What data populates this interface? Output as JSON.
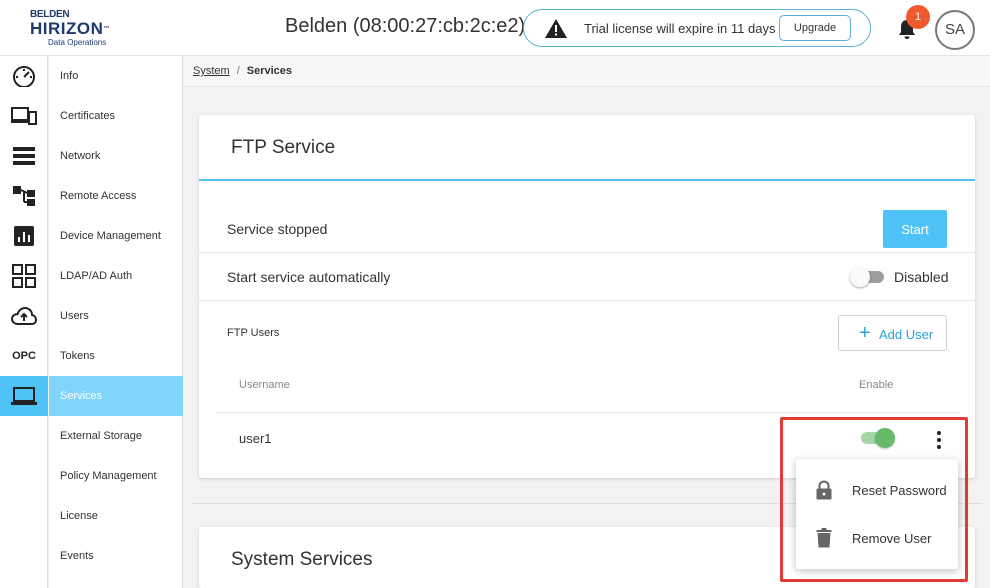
{
  "header": {
    "logo": {
      "line1": "BELDEN",
      "line2": "HIRIZON",
      "tm": "™",
      "line3": "Data Operations"
    },
    "device_title": "Belden (08:00:27:cb:2c:e2)",
    "license_text": "Trial license will expire in 11 days",
    "upgrade_label": "Upgrade",
    "notification_count": "1",
    "avatar_initials": "SA"
  },
  "rail": {
    "items": [
      {
        "icon": "dashboard-icon"
      },
      {
        "icon": "devices-icon"
      },
      {
        "icon": "list-icon"
      },
      {
        "icon": "workflow-icon"
      },
      {
        "icon": "analytics-icon"
      },
      {
        "icon": "apps-icon"
      },
      {
        "icon": "cloud-upload-icon"
      },
      {
        "icon": "opc-icon",
        "label": "OPC"
      },
      {
        "icon": "laptop-icon",
        "active": true
      }
    ],
    "active_color": "#4fc3f7"
  },
  "submenu": {
    "items": [
      {
        "label": "Info"
      },
      {
        "label": "Certificates"
      },
      {
        "label": "Network"
      },
      {
        "label": "Remote Access"
      },
      {
        "label": "Device Management"
      },
      {
        "label": "LDAP/AD Auth"
      },
      {
        "label": "Users"
      },
      {
        "label": "Tokens"
      },
      {
        "label": "Services",
        "active": true
      },
      {
        "label": "External Storage"
      },
      {
        "label": "Policy Management"
      },
      {
        "label": "License"
      },
      {
        "label": "Events"
      }
    ]
  },
  "breadcrumb": {
    "parent": "System",
    "separator": "/",
    "current": "Services"
  },
  "ftp": {
    "title": "FTP Service",
    "status": "Service stopped",
    "start_label": "Start",
    "auto_start_label": "Start service automatically",
    "auto_start_state": "Disabled",
    "users_label": "FTP Users",
    "add_user_plus": "+",
    "add_user_label": "Add User",
    "columns": {
      "username": "Username",
      "enable": "Enable"
    },
    "users": [
      {
        "username": "user1",
        "enabled": true
      }
    ]
  },
  "popup_menu": {
    "items": [
      {
        "label": "Reset Password",
        "icon": "lock-icon"
      },
      {
        "label": "Remove User",
        "icon": "trash-icon"
      }
    ]
  },
  "system_services": {
    "title": "System Services"
  },
  "colors": {
    "accent": "#4fc3f7",
    "highlight": "#e53935",
    "badge": "#ef5a2e",
    "toggle_on": "#66bb6a"
  }
}
